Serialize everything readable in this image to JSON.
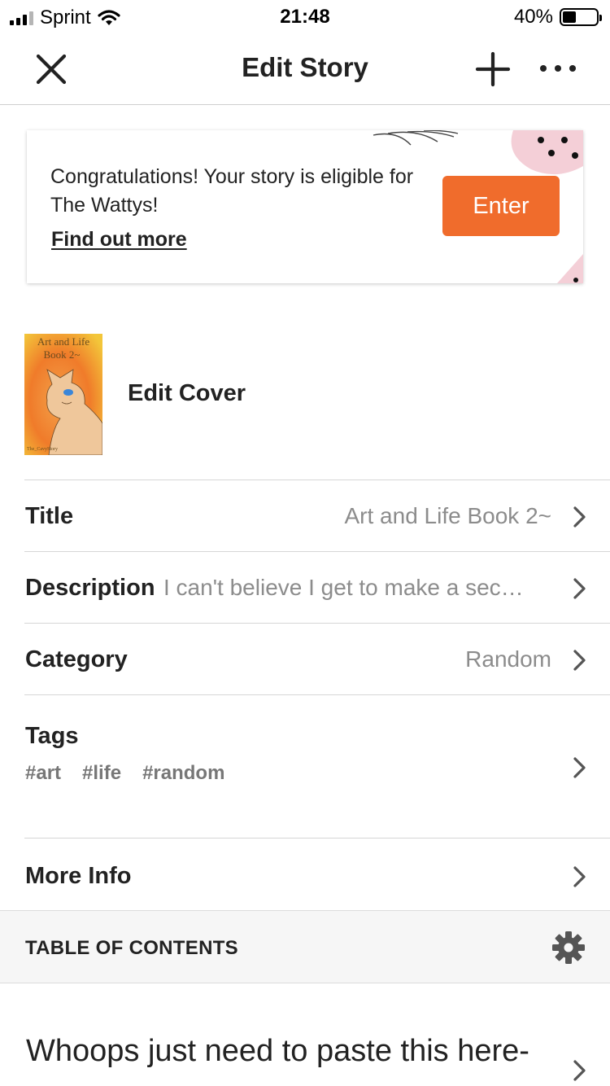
{
  "status_bar": {
    "carrier": "Sprint",
    "time": "21:48",
    "battery_percent_label": "40%",
    "battery_level": 0.4
  },
  "nav": {
    "title": "Edit Story",
    "close_icon": "close-icon",
    "add_icon": "plus-icon",
    "more_icon": "more-horizontal-icon"
  },
  "banner": {
    "message": "Congratulations! Your story is eligible for The Wattys!",
    "link": "Find out more",
    "button": "Enter",
    "accent_color": "#f06c2c"
  },
  "cover": {
    "label": "Edit Cover",
    "cover_text_line1": "Art and Life",
    "cover_text_line2": "Book 2~",
    "cover_author": "The_CavyStory"
  },
  "rows": {
    "title": {
      "label": "Title",
      "value": "Art and Life Book 2~"
    },
    "description": {
      "label": "Description",
      "value": "I can't believe I get to make a sec…"
    },
    "category": {
      "label": "Category",
      "value": "Random"
    },
    "tags": {
      "label": "Tags",
      "items": [
        "#art",
        "#life",
        "#random"
      ]
    },
    "more_info": {
      "label": "More Info"
    }
  },
  "toc": {
    "label": "TABLE OF CONTENTS",
    "icon": "gear-icon"
  },
  "parts": [
    {
      "title": "Whoops just need to paste this here-"
    }
  ]
}
